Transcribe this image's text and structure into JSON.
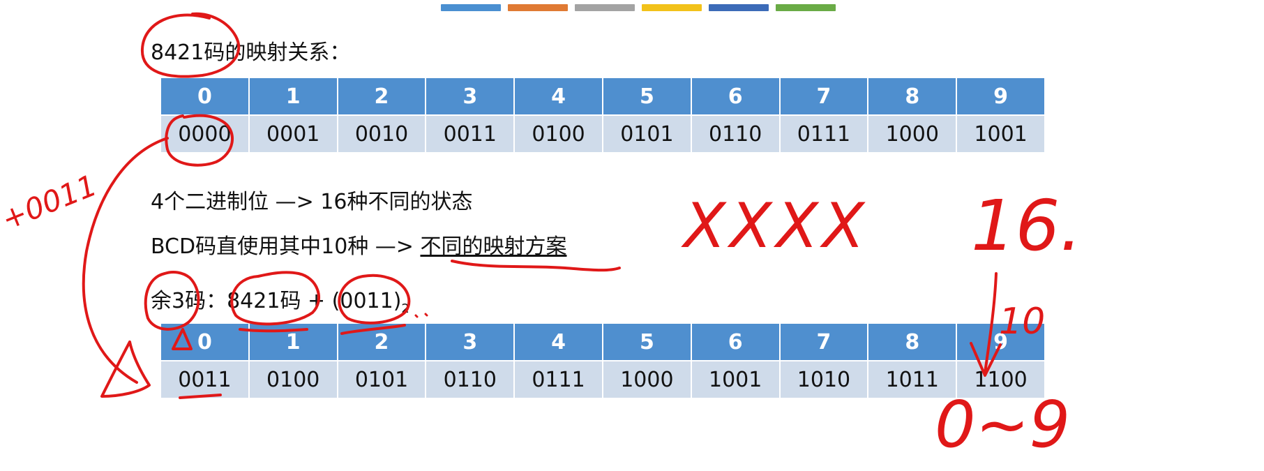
{
  "top_color_bars": [
    "#4a8fd1",
    "#e07a33",
    "#a3a3a3",
    "#f2c21a",
    "#3c6bb8",
    "#6aab46"
  ],
  "heading_8421": "8421码的映射关系：",
  "table_8421": {
    "headers": [
      "0",
      "1",
      "2",
      "3",
      "4",
      "5",
      "6",
      "7",
      "8",
      "9"
    ],
    "codes": [
      "0000",
      "0001",
      "0010",
      "0011",
      "0100",
      "0101",
      "0110",
      "0111",
      "1000",
      "1001"
    ]
  },
  "text_lines": {
    "binary_states": "4个二进制位  —> 16种不同的状态",
    "bcd_prefix": "BCD码直使用其中10种  —> ",
    "bcd_emphasis": "不同的映射方案",
    "excess3_label": "余3码：",
    "excess3_formula_main": "8421码 + (0011)",
    "excess3_formula_sub": "2"
  },
  "table_excess3": {
    "headers": [
      "0",
      "1",
      "2",
      "3",
      "4",
      "5",
      "6",
      "7",
      "8",
      "9"
    ],
    "codes": [
      "0011",
      "0100",
      "0101",
      "0110",
      "0111",
      "1000",
      "1001",
      "1010",
      "1011",
      "1100"
    ]
  },
  "handwriting": {
    "left_note": "+0011",
    "xxxx": "XXXX",
    "sixteen": "16.",
    "ten": "10",
    "range": "0~9"
  },
  "colors": {
    "ink": "#e01818",
    "header_blue": "#4f8fcf",
    "row_light": "#cfdbea"
  }
}
